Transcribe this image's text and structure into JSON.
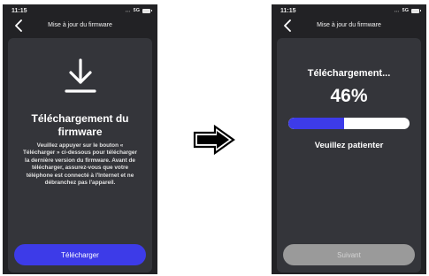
{
  "screens": [
    {
      "status_time": "11:15",
      "status_network": "5G",
      "nav_title": "Mise à jour du firmware",
      "icon": "download-icon",
      "title": "Téléchargement du firmware",
      "description": "Veuillez appuyer sur le bouton « Télécharger » ci-dessous pour télécharger la dernière version du firmware. Avant de télécharger, assurez-vous que votre téléphone est connecté à l'Internet et ne débranchez pas l'appareil.",
      "button_label": "Télécharger",
      "button_color": "#3d3be8"
    },
    {
      "status_time": "11:15",
      "status_network": "5G",
      "nav_title": "Mise à jour du firmware",
      "title": "Téléchargement...",
      "progress_text": "46%",
      "progress_value": 0.46,
      "subtitle": "Veuillez patienter",
      "button_label": "Suivant",
      "button_state": "disabled"
    }
  ],
  "transition_icon": "right-arrow-icon",
  "colors": {
    "background": "#ffffff",
    "phone_background": "#222225",
    "card_background": "#34353a",
    "accent": "#3d3be8",
    "disabled_button": "#9a9a9a"
  }
}
